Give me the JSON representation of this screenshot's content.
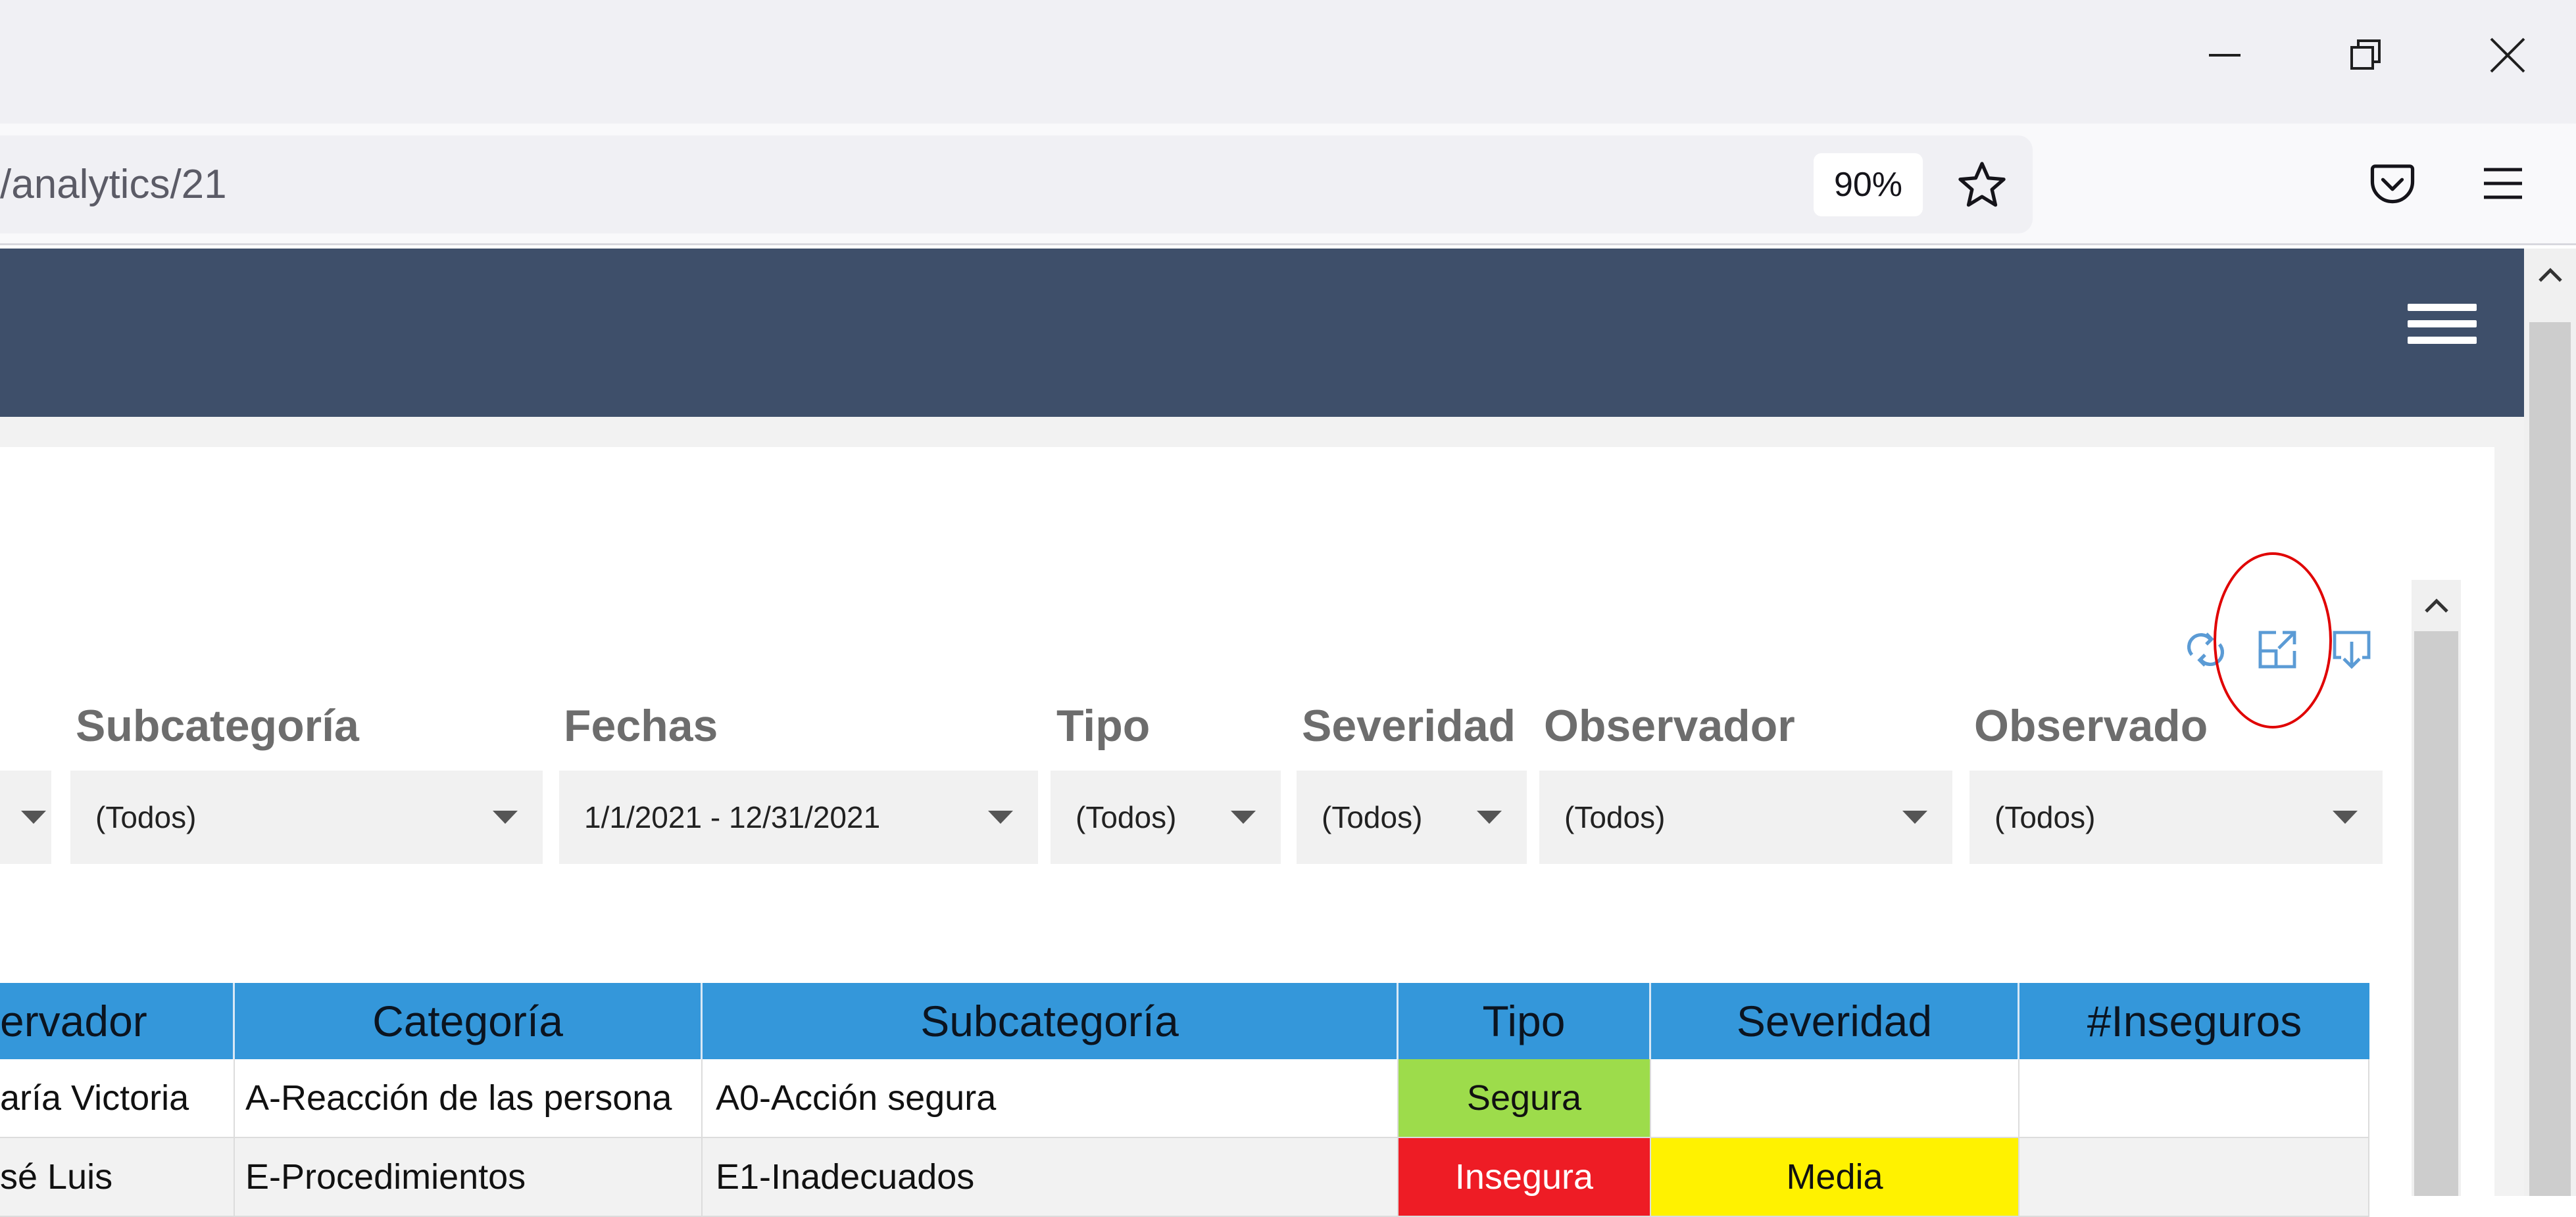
{
  "browser": {
    "url_fragment": "/analytics/21",
    "zoom": "90%",
    "icons": {
      "minimize": "minimize-icon",
      "restore": "restore-icon",
      "close": "close-icon",
      "bookmark": "star-icon",
      "pocket": "pocket-icon",
      "menu": "hamburger-menu-icon"
    }
  },
  "app": {
    "navbar_color": "#3e4f6a",
    "menu_icon": "hamburger-menu-icon"
  },
  "panel_toolbar": {
    "icons": [
      "refresh-icon",
      "expand-icon",
      "export-icon"
    ],
    "highlight_color": "#e00000"
  },
  "filters": [
    {
      "label": "",
      "value": ""
    },
    {
      "label": "Subcategoría",
      "value": "(Todos)"
    },
    {
      "label": "Fechas",
      "value": "1/1/2021 - 12/31/2021"
    },
    {
      "label": "Tipo",
      "value": "(Todos)"
    },
    {
      "label": "Severidad",
      "value": "(Todos)"
    },
    {
      "label": "Observador",
      "value": "(Todos)"
    },
    {
      "label": "Observado",
      "value": "(Todos)"
    }
  ],
  "table": {
    "header_color": "#3497da",
    "columns": [
      "ervador",
      "Categoría",
      "Subcategoría",
      "Tipo",
      "Severidad",
      "#Inseguros"
    ],
    "rows": [
      [
        "aría Victoria",
        "A-Reacción de las persona",
        "A0-Acción segura",
        "Segura",
        "",
        ""
      ],
      [
        "sé Luis",
        "E-Procedimientos",
        "E1-Inadecuados",
        "Insegura",
        "Media",
        ""
      ]
    ],
    "status_colors": {
      "Segura": "#9ddc4b",
      "Insegura": "#ee1c25",
      "Media": "#fff200"
    }
  }
}
